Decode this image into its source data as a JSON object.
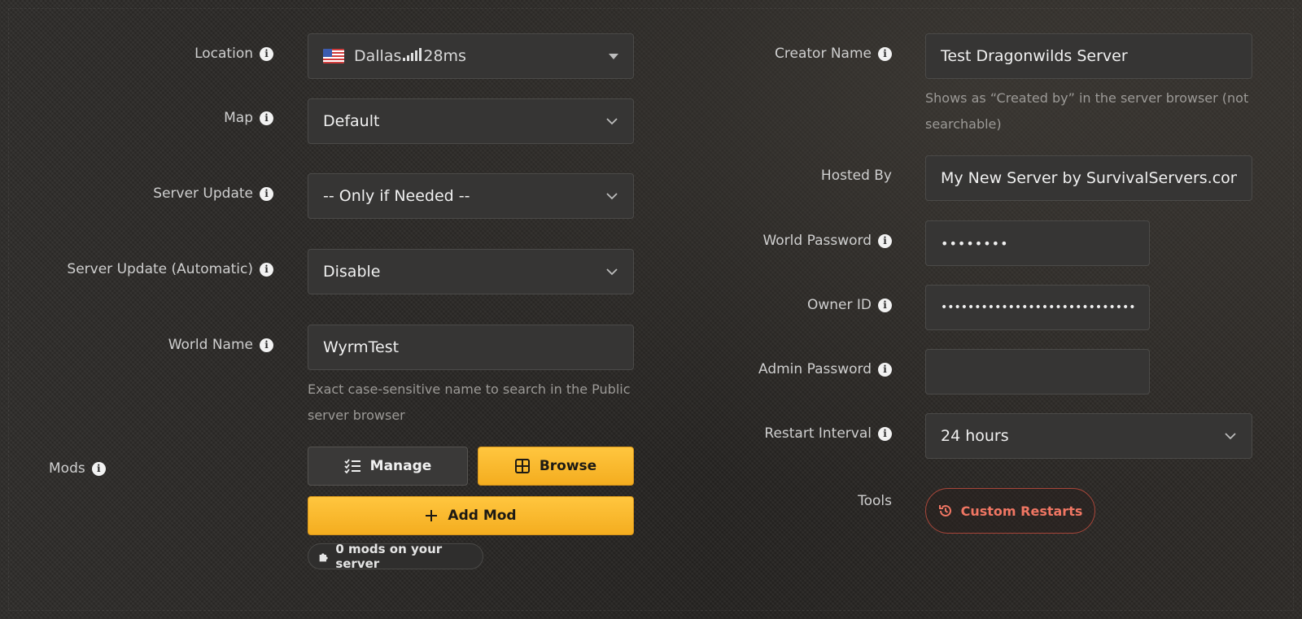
{
  "left": {
    "location": {
      "label": "Location",
      "city": "Dallas",
      "ping": "28ms"
    },
    "map": {
      "label": "Map",
      "value": "Default"
    },
    "server_update": {
      "label": "Server Update",
      "value": "-- Only if Needed --"
    },
    "server_update_auto": {
      "label": "Server Update (Automatic)",
      "value": "Disable"
    },
    "world_name": {
      "label": "World Name",
      "value": "WyrmTest",
      "help": "Exact case-sensitive name to search in the Public server browser"
    },
    "mods": {
      "label": "Mods",
      "manage_label": "Manage",
      "browse_label": "Browse",
      "add_label": "Add Mod",
      "count_text": "0 mods on your server"
    }
  },
  "right": {
    "creator_name": {
      "label": "Creator Name",
      "value": "Test Dragonwilds Server",
      "help": "Shows as “Created by” in the server browser (not searchable)"
    },
    "hosted_by": {
      "label": "Hosted By",
      "value": "My New Server by SurvivalServers.com"
    },
    "world_password": {
      "label": "World Password",
      "value": "••••••••"
    },
    "owner_id": {
      "label": "Owner ID",
      "value": "••••••••••••••••••••••••••••••••"
    },
    "admin_password": {
      "label": "Admin Password",
      "value": ""
    },
    "restart_interval": {
      "label": "Restart Interval",
      "value": "24 hours"
    },
    "tools": {
      "label": "Tools",
      "custom_restarts_label": "Custom Restarts"
    }
  },
  "colors": {
    "accent_yellow": "#f9b92c",
    "accent_red": "#f07663",
    "field_bg": "#363534"
  },
  "icons": {
    "info": "info-icon",
    "chevron": "chevron-down-icon",
    "manage": "list-icon",
    "browse": "grid-icon",
    "add": "plus-icon",
    "puzzle": "puzzle-icon",
    "restart": "history-icon",
    "flag": "us-flag-icon",
    "signal": "signal-icon"
  }
}
